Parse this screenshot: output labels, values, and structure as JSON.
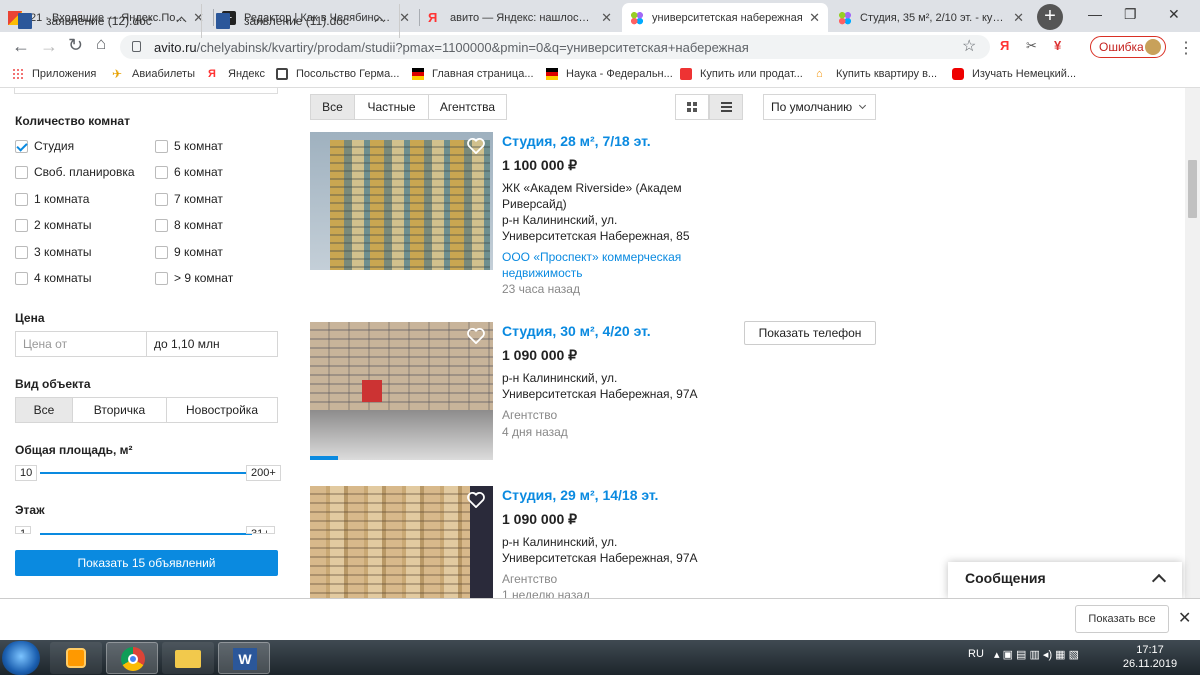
{
  "tabs": [
    {
      "title": "21 · Входящие — Яндекс.Почта",
      "icon": "gmail-icon"
    },
    {
      "title": "Редактор | Как в Челябинске п",
      "icon": "editor-icon"
    },
    {
      "title": "авито — Яндекс: нашлось 16 т",
      "icon": "yandex-icon"
    },
    {
      "title": "университетская набережная",
      "icon": "avito-icon"
    },
    {
      "title": "Студия, 35 м², 2/10 эт. - купить",
      "icon": "avito-icon"
    }
  ],
  "address": {
    "host": "avito.ru",
    "path": "/chelyabinsk/kvartiry/prodam/studii?pmax=1100000&pmin=0&q=университетская+набережная"
  },
  "toolbar": {
    "error_label": "Ошибка",
    "ya_label": "Я"
  },
  "bookmarks": [
    "Приложения",
    "Авиабилеты",
    "Яндекс",
    "Посольство Герма...",
    "Главная страница...",
    "Наука - Федеральн...",
    "Купить или продат...",
    "Купить квартиру в...",
    "Изучать Немецкий..."
  ],
  "filters": {
    "rooms_title": "Количество комнат",
    "rooms_left": [
      {
        "label": "Студия",
        "checked": true
      },
      {
        "label": "Своб. планировка"
      },
      {
        "label": "1 комната"
      },
      {
        "label": "2 комнаты"
      },
      {
        "label": "3 комнаты"
      },
      {
        "label": "4 комнаты"
      }
    ],
    "rooms_right": [
      {
        "label": "5 комнат"
      },
      {
        "label": "6 комнат"
      },
      {
        "label": "7 комнат"
      },
      {
        "label": "8 комнат"
      },
      {
        "label": "9 комнат"
      },
      {
        "label": "> 9 комнат"
      }
    ],
    "price_title": "Цена",
    "price_from_placeholder": "Цена от",
    "price_to_value": "до 1,10 млн",
    "type_title": "Вид объекта",
    "type_options": [
      "Все",
      "Вторичка",
      "Новостройка"
    ],
    "area_title": "Общая площадь, м²",
    "area_min": "10",
    "area_max": "200+",
    "floor_title": "Этаж",
    "floor_min": "1",
    "floor_max": "31+",
    "show_button": "Показать 15 объявлений"
  },
  "listing_header": {
    "seller_tabs": [
      "Все",
      "Частные",
      "Агентства"
    ],
    "sort": "По умолчанию"
  },
  "listings": [
    {
      "title": "Студия, 28 м², 7/18 эт.",
      "price": "1 100 000 ₽",
      "complex": "ЖК «Академ Riverside» (Академ Риверсайд)",
      "address": "р-н Калининский, ул. Университетская Набережная, 85",
      "seller": "ООО «Проспект» коммерческая недвижимость",
      "time": "23 часа назад"
    },
    {
      "title": "Студия, 30 м², 4/20 эт.",
      "price": "1 090 000 ₽",
      "address": "р-н Калининский, ул. Университетская Набережная, 97А",
      "seller": "Агентство",
      "time": "4 дня назад",
      "phone_button": "Показать телефон"
    },
    {
      "title": "Студия, 29 м², 14/18 эт.",
      "price": "1 090 000 ₽",
      "address": "р-н Калининский, ул. Университетская Набережная, 97А",
      "seller": "Агентство",
      "time": "1 неделю назад"
    }
  ],
  "messages": {
    "title": "Сообщения"
  },
  "downloads": {
    "items": [
      "заявление (12).doc",
      "заявление (11).doc"
    ],
    "show_all": "Показать все"
  },
  "taskbar": {
    "lang": "RU",
    "time": "17:17",
    "date": "26.11.2019"
  },
  "colors": {
    "accent": "#0a8ae0",
    "error": "#c5221f"
  }
}
